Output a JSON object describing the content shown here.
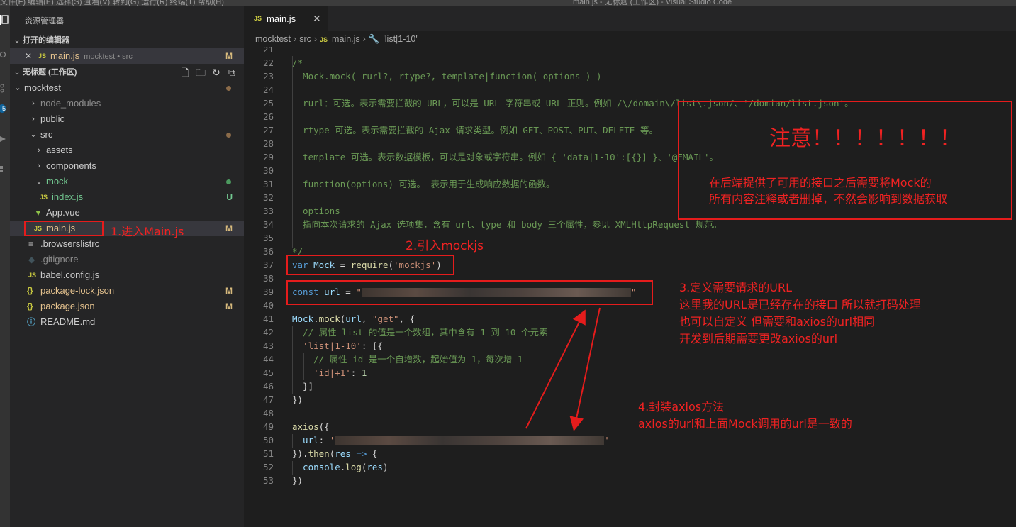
{
  "window": {
    "menu": "文件(F)   编辑(E)   选择(S)   查看(V)   转到(G)   运行(R)   终端(T)   帮助(H)",
    "title": "main.js - 无标题 (工作区) - Visual Studio Code"
  },
  "activity_bar": {
    "badge": "5"
  },
  "sidebar": {
    "title": "资源管理器",
    "open_editors_header": "打开的编辑器",
    "open_editor": {
      "close": "✕",
      "name": "main.js",
      "path": "mocktest • src",
      "status": "M"
    },
    "workspace_header": "无标题 (工作区)",
    "tree": [
      {
        "label": "mocktest"
      },
      {
        "label": "node_modules"
      },
      {
        "label": "public"
      },
      {
        "label": "src"
      },
      {
        "label": "assets"
      },
      {
        "label": "components"
      },
      {
        "label": "mock"
      },
      {
        "label": "index.js",
        "status": "U"
      },
      {
        "label": "App.vue"
      },
      {
        "label": "main.js",
        "status": "M"
      },
      {
        "label": ".browserslistrc"
      },
      {
        "label": ".gitignore"
      },
      {
        "label": "babel.config.js"
      },
      {
        "label": "package-lock.json",
        "status": "M"
      },
      {
        "label": "package.json",
        "status": "M"
      },
      {
        "label": "README.md"
      }
    ]
  },
  "editor": {
    "tab": {
      "label": "main.js",
      "close": "✕"
    },
    "breadcrumb": {
      "root": "mocktest",
      "folder": "src",
      "file": "main.js",
      "symbol": "'list|1-10'"
    },
    "line_numbers": [
      "21",
      "22",
      "23",
      "24",
      "25",
      "26",
      "27",
      "28",
      "29",
      "30",
      "31",
      "32",
      "33",
      "34",
      "35",
      "36",
      "37",
      "38",
      "39",
      "40",
      "41",
      "42",
      "43",
      "44",
      "45",
      "46",
      "47",
      "48",
      "49",
      "50",
      "51",
      "52",
      "53"
    ],
    "code": {
      "l22": "/*",
      "l23": "  Mock.mock( rurl?, rtype?, template|function( options ) )",
      "l25": "  rurl：可选。表示需要拦截的 URL，可以是 URL 字符串或 URL 正则。例如 /\\/domain\\/list\\.json/、'/domian/list.json'。",
      "l27": "  rtype 可选。表示需要拦截的 Ajax 请求类型。例如 GET、POST、PUT、DELETE 等。",
      "l29": "  template 可选。表示数据模板，可以是对象或字符串。例如 { 'data|1-10':[{}] }、'@EMAIL'。",
      "l31": "  function(options) 可选。 表示用于生成响应数据的函数。",
      "l33": "  options",
      "l34": "  指向本次请求的 Ajax 选项集，含有 url、type 和 body 三个属性，参见 XMLHttpRequest 规范。",
      "l36": "*/",
      "l37_var": "var",
      "l37_name": " Mock",
      "l37_eq": " = ",
      "l37_fn": "require",
      "l37_open": "(",
      "l37_str": "'mockjs'",
      "l37_close": ")",
      "l39_const": "const",
      "l39_name": " url",
      "l39_eq": " = ",
      "l39_q1": "\"",
      "l39_q2": "\"",
      "l41_obj": "Mock",
      "l41_dot": ".",
      "l41_fn": "mock",
      "l41_open": "(",
      "l41_arg": "url",
      "l41_comma": ", ",
      "l41_str": "\"get\"",
      "l41_rest": ", {",
      "l42": "  // 属性 list 的值是一个数组，其中含有 1 到 10 个元素",
      "l43_str": "  'list|1-10'",
      "l43_rest": ": [{",
      "l44": "    // 属性 id 是一个自增数，起始值为 1，每次增 1",
      "l45_str": "    'id|+1'",
      "l45_colon": ": ",
      "l45_num": "1",
      "l46": "  }]",
      "l47": "})",
      "l49_fn": "axios",
      "l49_rest": "({",
      "l50_key": "  url",
      "l50_colon": ": ",
      "l50_q1": "'",
      "l50_q2": "'",
      "l51_a": "}).",
      "l51_fn": "then",
      "l51_open": "(",
      "l51_param": "res",
      "l51_arrow": " => ",
      "l51_brace": "{",
      "l52_obj": "  console",
      "l52_dot": ".",
      "l52_fn": "log",
      "l52_open": "(",
      "l52_arg": "res",
      "l52_close": ")",
      "l53": "})"
    }
  },
  "annotations": {
    "a1": "1.进入Main.js",
    "a2": "2.引入mockjs",
    "a3": [
      "3.定义需要请求的URL",
      "这里我的URL是已经存在的接口 所以就打码处理",
      "也可以自定义 但需要和axios的url相同",
      "开发到后期需要更改axios的url"
    ],
    "a4": [
      "4.封装axios方法",
      "axios的url和上面Mock调用的url是一致的"
    ],
    "note_title": "注意！！！！！！！",
    "note_body": [
      "在后端提供了可用的接口之后需要将Mock的",
      "所有内容注释或者删掉，不然会影响到数据获取"
    ]
  },
  "colors": {
    "annotation_red": "#e51c1c",
    "editor_bg": "#1e1e1e",
    "sidebar_bg": "#252526"
  }
}
